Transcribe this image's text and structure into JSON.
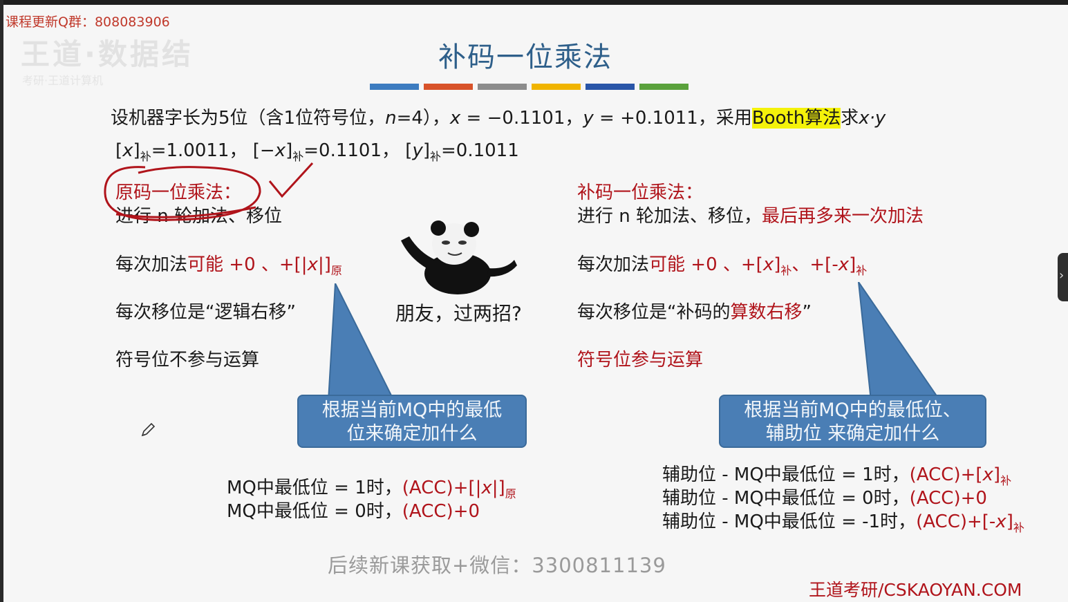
{
  "overlay": {
    "qq_group": "课程更新Q群：808083906",
    "logo_ghost": "王道·数据结",
    "logo_ghost_sub": "考研·王道计算机",
    "watermark": "后续新课获取+微信：3300811139",
    "brand": "王道考研/CSKAOYAN.COM"
  },
  "slide": {
    "title": "补码一位乘法",
    "title_color": "#2e5f8a",
    "color_bars": [
      "#3d7cc0",
      "#d8532a",
      "#8c8c8c",
      "#f0b400",
      "#2a56a8",
      "#5aa13c"
    ],
    "problem": {
      "p1": "设机器字长为5位（含1位符号位，",
      "n_var": "n",
      "p2": "=4），",
      "x_var": "x",
      "p3": " = −0.1101，",
      "y_var": "y",
      "p4": " = +0.1011，采用",
      "highlight": "Booth算法",
      "p5": "求",
      "xy": "x·y"
    },
    "complements": {
      "open1": "[",
      "x1": "x",
      "close1": "]",
      "sub1": "补",
      "val1": "=1.0011，",
      "open2": "[−",
      "x2": "x",
      "close2": "]",
      "sub2": "补",
      "val2": "=0.1101，",
      "open3": "[",
      "y3": "y",
      "close3": "]",
      "sub3": "补",
      "val3": "=0.1011"
    },
    "left": {
      "heading": "原码一位乘法：",
      "line1": "进行 n 轮加法、移位",
      "add_prefix": "每次加法",
      "add_red": "可能 +0 、+[|",
      "add_x": "x",
      "add_red2": "|]",
      "add_sub": "原",
      "shift": "每次移位是“逻辑右移”",
      "sign": "符号位不参与运算",
      "callout": [
        "根据当前MQ中的最低",
        "位来确定加什么"
      ],
      "rule1_black": "MQ中最低位 = 1时，",
      "rule1_red": "(ACC)+[|",
      "rule1_x": "x",
      "rule1_red2": "|]",
      "rule1_sub": "原",
      "rule2_black": "MQ中最低位 = 0时，",
      "rule2_red": "(ACC)+0"
    },
    "meme_caption": "朋友，过两招?",
    "right": {
      "heading": "补码一位乘法：",
      "line1_black": "进行 n 轮加法、移位，",
      "line1_red": "最后再多来一次加法",
      "add_prefix": "每次加法",
      "add_red1": "可能 +0 、+[",
      "add_x1": "x",
      "add_red1b": "]",
      "add_sub1": "补",
      "add_sep": "、",
      "add_red2": "+[-",
      "add_x2": "x",
      "add_red2b": "]",
      "add_sub2": "补",
      "shift_black1": "每次移位是“补码的",
      "shift_red": "算数右移",
      "shift_black2": "”",
      "sign": "符号位参与运算",
      "callout": [
        "根据当前MQ中的最低位、",
        "辅助位 来确定加什么"
      ],
      "rule1_black": "辅助位 - MQ中最低位 = 1时，",
      "rule1_red": "(ACC)+[",
      "rule1_x": "x",
      "rule1_red2": "]",
      "rule1_sub": "补",
      "rule2_black": "辅助位 - MQ中最低位 = 0时，",
      "rule2_red": "(ACC)+0",
      "rule3_black": "辅助位 - MQ中最低位 = -1时，",
      "rule3_red": "(ACC)+[-",
      "rule3_x": "x",
      "rule3_red2": "]",
      "rule3_sub": "补"
    }
  },
  "ui": {
    "side_handle_icon": "›"
  }
}
